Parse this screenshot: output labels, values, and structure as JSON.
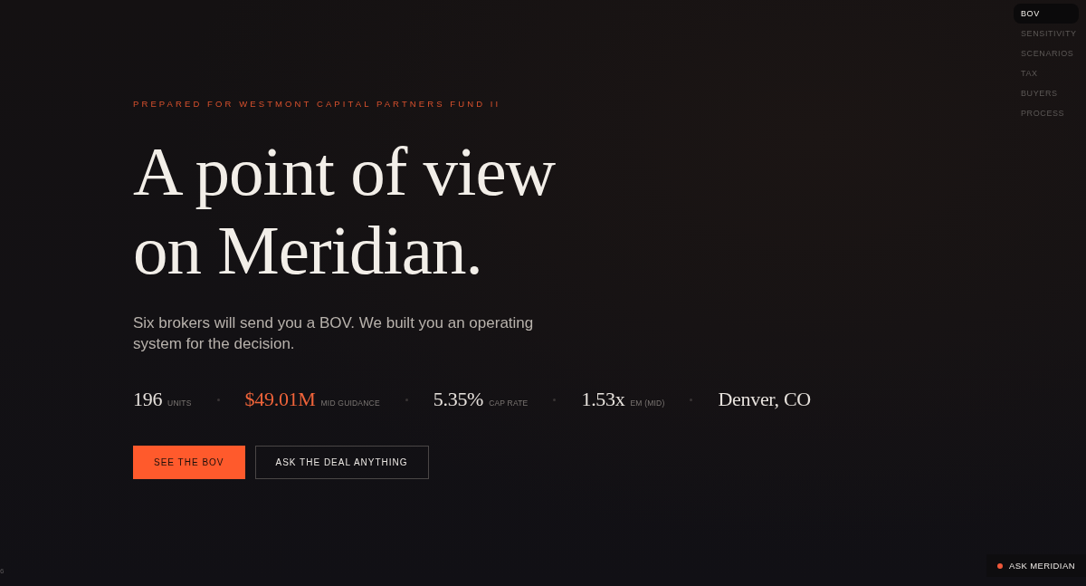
{
  "nav": {
    "items": [
      {
        "label": "BOV",
        "selected": true
      },
      {
        "label": "SENSITIVITY",
        "selected": false
      },
      {
        "label": "SCENARIOS",
        "selected": false
      },
      {
        "label": "TAX",
        "selected": false
      },
      {
        "label": "BUYERS",
        "selected": false
      },
      {
        "label": "PROCESS",
        "selected": false
      }
    ]
  },
  "hero": {
    "eyebrow": "PREPARED FOR WESTMONT CAPITAL PARTNERS FUND II",
    "headline": "A point of view on Meridian.",
    "subtitle": "Six brokers will send you a BOV. We built you an operating system for the decision."
  },
  "stats": [
    {
      "value": "196",
      "label": "UNITS",
      "highlight": false
    },
    {
      "value": "$49.01M",
      "label": "MID GUIDANCE",
      "highlight": true
    },
    {
      "value": "5.35%",
      "label": "CAP RATE",
      "highlight": false
    },
    {
      "value": "1.53x",
      "label": "EM (MID)",
      "highlight": false
    },
    {
      "value": "Denver, CO",
      "highlight": false
    }
  ],
  "buttons": [
    {
      "label": "SEE THE BOV",
      "kind": "primary"
    },
    {
      "label": "ASK THE DEAL ANYTHING",
      "kind": "outline"
    }
  ],
  "assistant_button": {
    "label": "ASK MERIDIAN"
  },
  "edge_text": "6"
}
